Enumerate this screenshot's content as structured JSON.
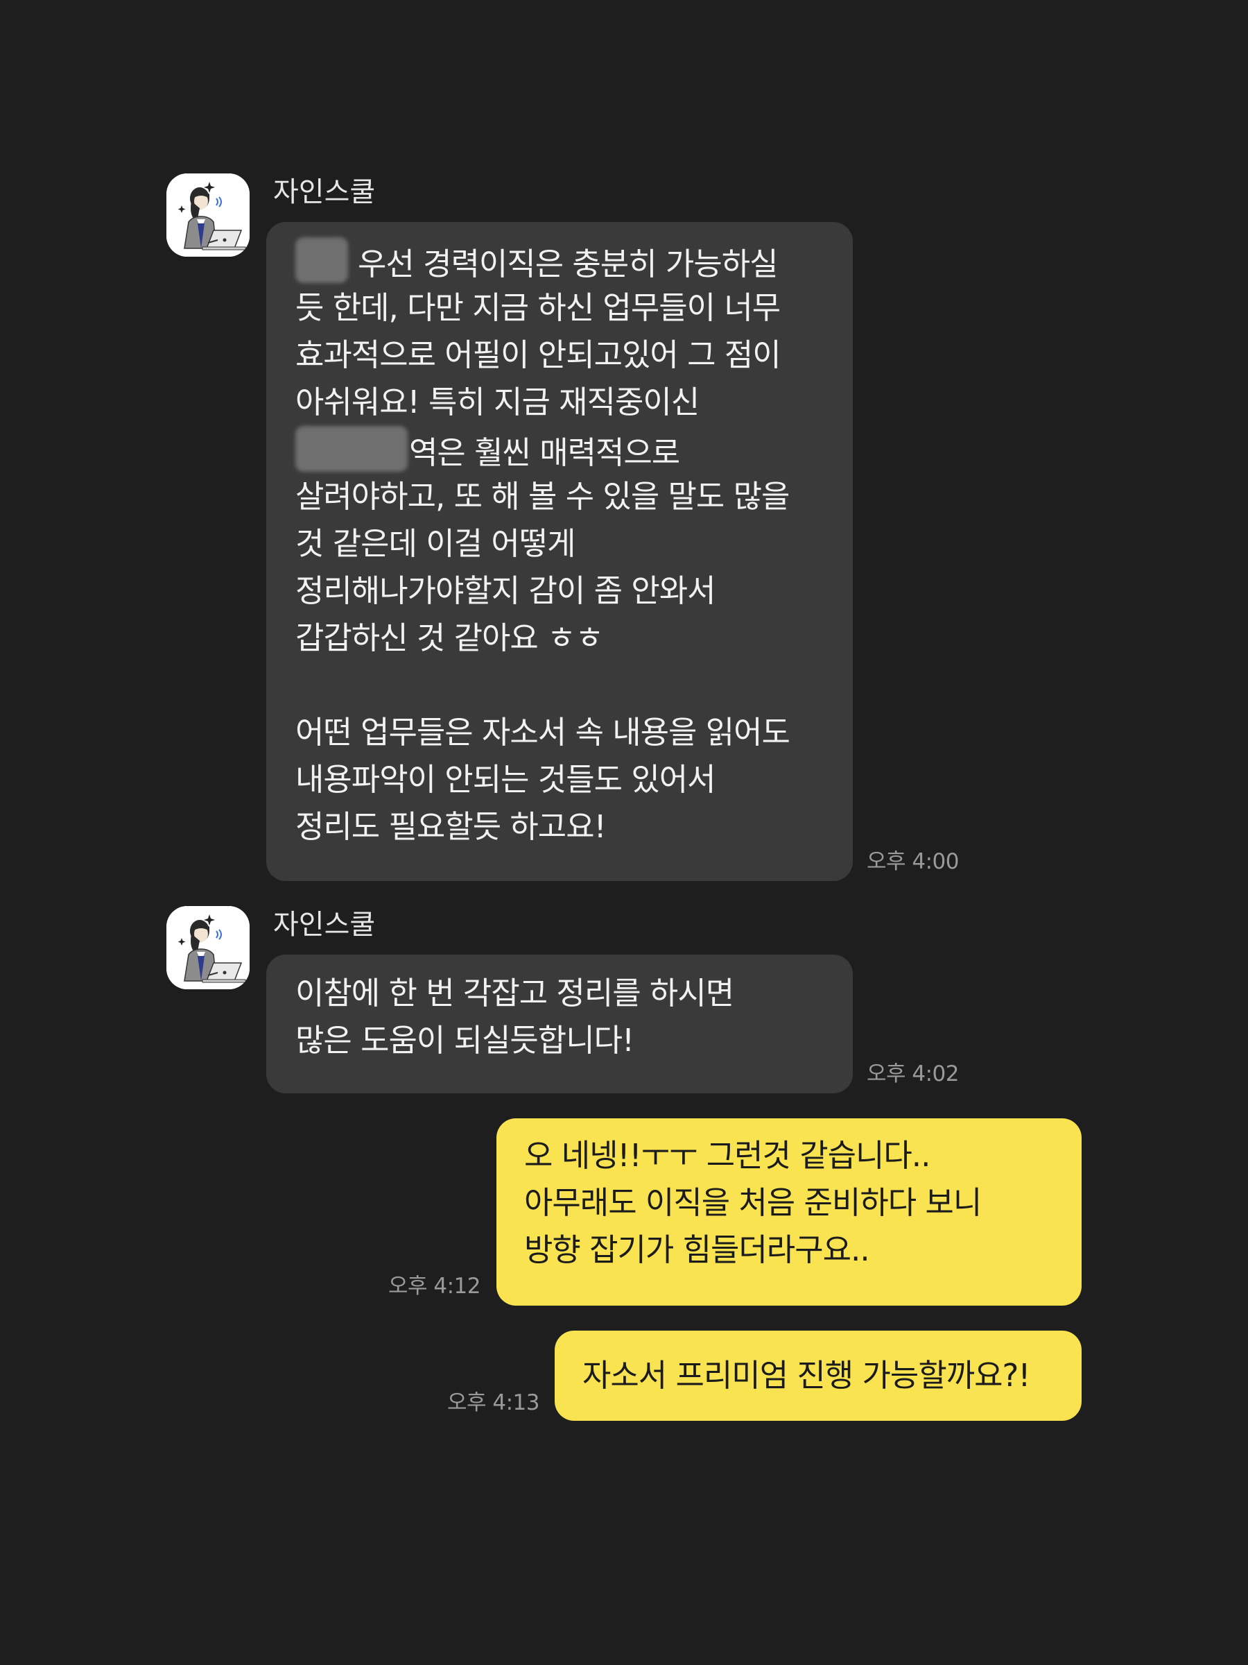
{
  "messages": [
    {
      "sender": "자인스쿨",
      "avatar_icon": "woman-with-laptop-icon",
      "time": "오후 4:00",
      "lines": [
        "우선 경력이직은 충분히 가능하실",
        "듯 한데, 다만 지금 하신 업무들이 너무",
        "효과적으로 어필이 안되고있어 그 점이",
        "아쉬워요! 특히 지금 재직중이신",
        "역은 훨씬 매력적으로",
        "살려야하고, 또 해 볼 수 있을 말도 많을",
        "것 같은데 이걸 어떻게",
        "정리해나가야할지 감이 좀 안와서",
        "갑갑하신 것 같아요 ㅎㅎ",
        "",
        "어떤 업무들은 자소서 속 내용을 읽어도",
        "내용파악이 안되는 것들도 있어서",
        "정리도 필요할듯 하고요!"
      ]
    },
    {
      "sender": "자인스쿨",
      "avatar_icon": "woman-with-laptop-icon",
      "time": "오후 4:02",
      "lines": [
        "이참에 한 번 각잡고 정리를 하시면",
        "많은 도움이 되실듯합니다!"
      ]
    },
    {
      "sender": "me",
      "time": "오후 4:12",
      "lines": [
        "오 네넹!!ㅜㅜ 그런것 같습니다..",
        "아무래도 이직을 처음 준비하다 보니",
        "방향 잡기가 힘들더라구요.."
      ]
    },
    {
      "sender": "me",
      "time": "오후 4:13",
      "lines": [
        "자소서 프리미엄 진행 가능할까요?!"
      ]
    }
  ],
  "colors": {
    "background": "#1e1e1e",
    "incoming_bubble": "#3a3a3a",
    "outgoing_bubble": "#fae350",
    "timestamp": "#9a9a9a"
  }
}
